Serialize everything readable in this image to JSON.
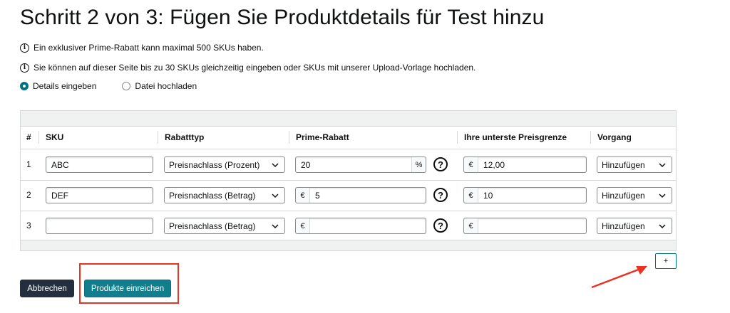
{
  "title": "Schritt 2 von 3: Fügen Sie Produktdetails für Test hinzu",
  "info": [
    "Ein exklusiver Prime-Rabatt kann maximal 500 SKUs haben.",
    "Sie können auf dieser Seite bis zu 30 SKUs gleichzeitig eingeben oder SKUs mit unserer Upload-Vorlage hochladen."
  ],
  "info_icon_glyph": "i",
  "radio": {
    "details_label": "Details eingeben",
    "upload_label": "Datei hochladen",
    "selected": "details"
  },
  "table": {
    "headers": {
      "num": "#",
      "sku": "SKU",
      "discount_type": "Rabatttyp",
      "prime_discount": "Prime-Rabatt",
      "price_floor": "Ihre unterste Preisgrenze",
      "action": "Vorgang"
    },
    "rows": [
      {
        "num": "1",
        "sku": "ABC",
        "discount_type": "Preisnachlass (Prozent)",
        "prime_discount": "20",
        "prime_unit": "%",
        "price_floor_currency": "€",
        "price_floor": "12,00",
        "action": "Hinzufügen"
      },
      {
        "num": "2",
        "sku": "DEF",
        "discount_type": "Preisnachlass (Betrag)",
        "prime_currency": "€",
        "prime_discount": "5",
        "price_floor_currency": "€",
        "price_floor": "10",
        "action": "Hinzufügen"
      },
      {
        "num": "3",
        "sku": "",
        "discount_type": "Preisnachlass (Betrag)",
        "prime_currency": "€",
        "prime_discount": "",
        "price_floor_currency": "€",
        "price_floor": "",
        "action": "Hinzufügen"
      }
    ],
    "help_glyph": "?"
  },
  "add_row_label": "+",
  "buttons": {
    "cancel": "Abbrechen",
    "submit": "Produkte einreichen"
  },
  "annotation_color": "#ea3323",
  "colors": {
    "teal": "#107e8c",
    "dark": "#232f3e"
  },
  "icons": {
    "info": "info-circle-icon",
    "help": "question-circle-icon",
    "select": "chevron-down-icon"
  }
}
